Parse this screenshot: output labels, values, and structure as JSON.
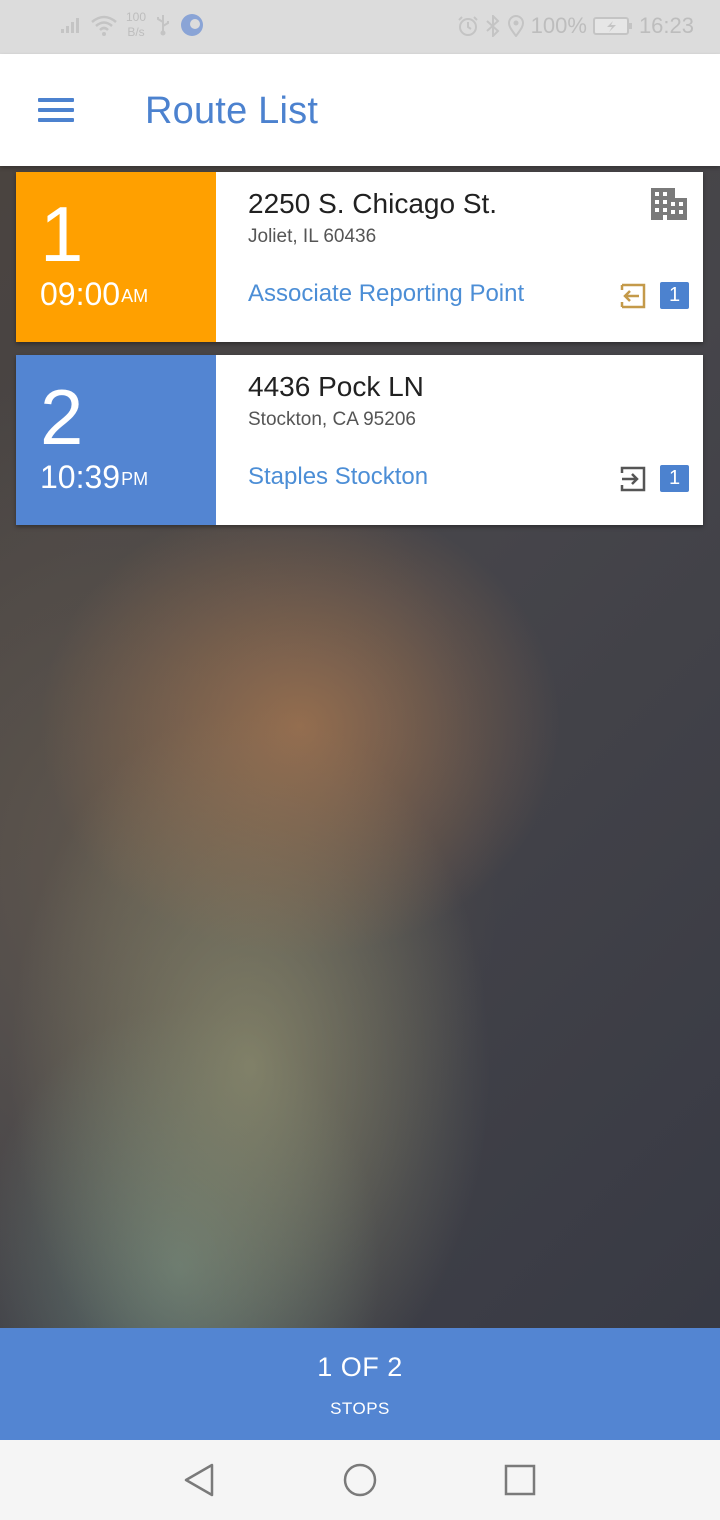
{
  "status_bar": {
    "net_speed_value": "100",
    "net_speed_unit": "B/s",
    "battery_percent": "100%",
    "time": "16:23"
  },
  "app_bar": {
    "title": "Route List",
    "menu_icon": "hamburger-menu-icon"
  },
  "stops": [
    {
      "sequence": "1",
      "time": "09:00",
      "period": "AM",
      "address_line1": "2250 S. Chicago St.",
      "address_line2": "Joliet, IL 60436",
      "location_name": "Associate Reporting Point",
      "panel_color": "#ffa000",
      "action_icon": "arrival-icon",
      "action_icon_color": "#c49a4a",
      "count": "1",
      "has_building_icon": true
    },
    {
      "sequence": "2",
      "time": "10:39",
      "period": "PM",
      "address_line1": "4436 Pock LN",
      "address_line2": "Stockton, CA 95206",
      "location_name": "Staples Stockton",
      "panel_color": "#5385d2",
      "action_icon": "exit-icon",
      "action_icon_color": "#555555",
      "count": "1",
      "has_building_icon": false
    }
  ],
  "footer": {
    "stops_count": "1 OF 2",
    "stops_label": "STOPS"
  },
  "colors": {
    "accent": "#4c82cf",
    "link": "#4c8ed6",
    "footer": "#5385d2"
  }
}
